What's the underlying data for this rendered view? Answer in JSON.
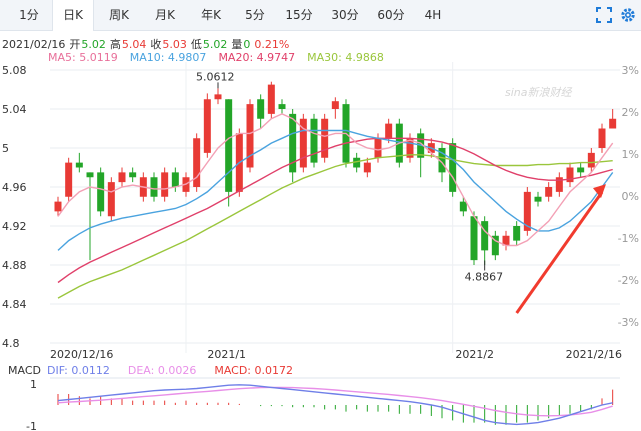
{
  "tabs": [
    "1分",
    "日K",
    "周K",
    "月K",
    "年K",
    "5分",
    "15分",
    "30分",
    "60分",
    "4H"
  ],
  "active_tab": "日K",
  "icons": [
    "fullscreen-icon",
    "settings-icon"
  ],
  "quote": {
    "date": "2021/02/16",
    "open_label": "开",
    "open": "5.02",
    "high_label": "高",
    "high": "5.04",
    "close_label": "收",
    "close": "5.03",
    "low_label": "低",
    "low": "5.02",
    "vol_label": "量",
    "vol": "0",
    "change": "0.21%"
  },
  "ma": {
    "ma5": "MA5: 5.0119",
    "ma10": "MA10: 4.9807",
    "ma20": "MA20: 4.9747",
    "ma30": "MA30: 4.9868"
  },
  "macd_legend": {
    "label": "MACD",
    "dif": "DIF: 0.0112",
    "dea": "DEA: 0.0026",
    "macd": "MACD: 0.0172"
  },
  "watermark": "sina新浪财经",
  "colors": {
    "up": "#e83a35",
    "down": "#23a528",
    "ma5": "#f3a0b5",
    "ma10": "#4aa3df",
    "ma20": "#e0406a",
    "ma30": "#9ac63c",
    "dif": "#6f7fe8",
    "dea": "#e88fe8",
    "arrow": "#f13b2e",
    "bg": "#ffffff"
  },
  "chart_data": {
    "type": "candlestick",
    "y_left_ticks": [
      "5.08",
      "5.04",
      "5",
      "4.96",
      "4.92",
      "4.88",
      "4.84",
      "4.8"
    ],
    "y_right_ticks": [
      "3%",
      "2%",
      "1%",
      "0%",
      "-1%",
      "-2%",
      "-3%"
    ],
    "ylim": [
      4.8,
      5.08
    ],
    "x_labels": [
      "2020/12/16",
      "2021/1",
      "2021/2",
      "2021/2/16"
    ],
    "annotations": [
      "5.0612",
      "4.8867"
    ],
    "candles": [
      [
        4.935,
        4.945,
        4.93,
        4.95
      ],
      [
        4.95,
        4.985,
        4.945,
        4.99
      ],
      [
        4.985,
        4.98,
        4.975,
        4.995
      ],
      [
        4.975,
        4.97,
        4.885,
        4.975
      ],
      [
        4.975,
        4.935,
        4.93,
        4.98
      ],
      [
        4.93,
        4.965,
        4.925,
        4.97
      ],
      [
        4.965,
        4.975,
        4.96,
        4.98
      ],
      [
        4.975,
        4.97,
        4.965,
        4.98
      ],
      [
        4.95,
        4.97,
        4.945,
        4.975
      ],
      [
        4.97,
        4.95,
        4.945,
        4.975
      ],
      [
        4.95,
        4.975,
        4.945,
        4.98
      ],
      [
        4.975,
        4.96,
        4.955,
        4.98
      ],
      [
        4.955,
        4.97,
        4.95,
        4.975
      ],
      [
        4.96,
        5.01,
        4.955,
        5.015
      ],
      [
        4.995,
        5.05,
        4.99,
        5.056
      ],
      [
        5.05,
        5.055,
        5.045,
        5.0612
      ],
      [
        5.05,
        4.955,
        4.94,
        5.05
      ],
      [
        4.955,
        5.015,
        4.95,
        5.02
      ],
      [
        4.98,
        5.045,
        4.975,
        5.05
      ],
      [
        5.05,
        5.03,
        5.02,
        5.055
      ],
      [
        5.035,
        5.065,
        5.03,
        5.068
      ],
      [
        5.045,
        5.04,
        5.035,
        5.05
      ],
      [
        5.035,
        4.975,
        4.965,
        5.04
      ],
      [
        4.98,
        5.03,
        4.975,
        5.035
      ],
      [
        5.03,
        4.985,
        4.98,
        5.035
      ],
      [
        4.99,
        5.03,
        4.985,
        5.035
      ],
      [
        5.04,
        5.048,
        5.03,
        5.052
      ],
      [
        5.045,
        4.985,
        4.98,
        5.05
      ],
      [
        4.99,
        4.98,
        4.975,
        4.995
      ],
      [
        4.975,
        4.985,
        4.97,
        4.99
      ],
      [
        4.99,
        5.01,
        4.985,
        5.015
      ],
      [
        5.01,
        5.025,
        5.005,
        5.03
      ],
      [
        5.025,
        4.985,
        4.98,
        5.03
      ],
      [
        4.99,
        5.01,
        4.985,
        5.015
      ],
      [
        5.015,
        4.99,
        4.97,
        5.02
      ],
      [
        4.995,
        5.005,
        4.99,
        5.01
      ],
      [
        5.0,
        4.975,
        4.965,
        5.005
      ],
      [
        5.005,
        4.955,
        4.95,
        5.01
      ],
      [
        4.945,
        4.935,
        4.93,
        4.95
      ],
      [
        4.93,
        4.885,
        4.88,
        4.935
      ],
      [
        4.925,
        4.895,
        4.88,
        4.93
      ],
      [
        4.91,
        4.89,
        4.885,
        4.915
      ],
      [
        4.9,
        4.91,
        4.895,
        4.915
      ],
      [
        4.92,
        4.905,
        4.9,
        4.925
      ],
      [
        4.915,
        4.955,
        4.91,
        4.96
      ],
      [
        4.95,
        4.945,
        4.94,
        4.955
      ],
      [
        4.95,
        4.96,
        4.945,
        4.965
      ],
      [
        4.955,
        4.97,
        4.95,
        4.975
      ],
      [
        4.965,
        4.98,
        4.96,
        4.985
      ],
      [
        4.98,
        4.975,
        4.97,
        4.985
      ],
      [
        4.98,
        4.995,
        4.975,
        5.0
      ],
      [
        5.0,
        5.02,
        4.995,
        5.025
      ],
      [
        5.02,
        5.03,
        5.02,
        5.04
      ]
    ],
    "ma5": [
      4.93,
      4.945,
      4.955,
      4.96,
      4.958,
      4.955,
      4.96,
      4.962,
      4.96,
      4.958,
      4.958,
      4.96,
      4.963,
      4.97,
      4.985,
      5.0,
      5.01,
      5.015,
      5.015,
      5.02,
      5.03,
      5.035,
      5.03,
      5.02,
      5.015,
      5.012,
      5.015,
      5.015,
      5.005,
      5.0,
      4.998,
      5.0,
      5.005,
      5.008,
      5.005,
      4.995,
      4.985,
      4.97,
      4.95,
      4.93,
      4.915,
      4.905,
      4.9,
      4.9,
      4.905,
      4.915,
      4.925,
      4.94,
      4.955,
      4.965,
      4.975,
      4.99,
      5.005
    ],
    "ma10": [
      4.895,
      4.905,
      4.912,
      4.918,
      4.922,
      4.925,
      4.928,
      4.93,
      4.932,
      4.934,
      4.936,
      4.938,
      4.942,
      4.948,
      4.955,
      4.965,
      4.975,
      4.985,
      4.992,
      4.998,
      5.005,
      5.01,
      5.015,
      5.018,
      5.018,
      5.018,
      5.018,
      5.018,
      5.015,
      5.012,
      5.01,
      5.008,
      5.006,
      5.005,
      5.003,
      5.0,
      4.995,
      4.988,
      4.978,
      4.965,
      4.955,
      4.945,
      4.935,
      4.927,
      4.92,
      4.915,
      4.915,
      4.918,
      4.925,
      4.935,
      4.945,
      4.96,
      4.975
    ],
    "ma20": [
      4.862,
      4.87,
      4.877,
      4.883,
      4.888,
      4.893,
      4.898,
      4.903,
      4.908,
      4.913,
      4.918,
      4.923,
      4.928,
      4.933,
      4.938,
      4.944,
      4.95,
      4.956,
      4.962,
      4.968,
      4.974,
      4.98,
      4.985,
      4.99,
      4.994,
      4.998,
      5.002,
      5.005,
      5.007,
      5.009,
      5.01,
      5.01,
      5.01,
      5.01,
      5.009,
      5.008,
      5.006,
      5.003,
      4.999,
      4.994,
      4.988,
      4.982,
      4.977,
      4.973,
      4.97,
      4.968,
      4.967,
      4.967,
      4.968,
      4.97,
      4.972,
      4.975,
      4.978
    ],
    "ma30": [
      4.846,
      4.852,
      4.858,
      4.863,
      4.867,
      4.871,
      4.875,
      4.88,
      4.885,
      4.89,
      4.895,
      4.9,
      4.905,
      4.911,
      4.917,
      4.923,
      4.929,
      4.935,
      4.941,
      4.947,
      4.953,
      4.959,
      4.964,
      4.969,
      4.973,
      4.977,
      4.981,
      4.984,
      4.986,
      4.988,
      4.99,
      4.991,
      4.992,
      4.993,
      4.993,
      4.992,
      4.99,
      4.988,
      4.986,
      4.984,
      4.983,
      4.982,
      4.982,
      4.982,
      4.982,
      4.983,
      4.983,
      4.984,
      4.984,
      4.985,
      4.985,
      4.986,
      4.987
    ],
    "macd_ticks": [
      "1",
      "-1"
    ],
    "dif": [
      0.2,
      0.25,
      0.3,
      0.35,
      0.4,
      0.45,
      0.5,
      0.55,
      0.6,
      0.65,
      0.68,
      0.7,
      0.72,
      0.75,
      0.8,
      0.85,
      0.9,
      0.92,
      0.9,
      0.85,
      0.8,
      0.75,
      0.7,
      0.65,
      0.6,
      0.55,
      0.5,
      0.45,
      0.4,
      0.35,
      0.3,
      0.25,
      0.2,
      0.15,
      0.08,
      0.0,
      -0.1,
      -0.25,
      -0.4,
      -0.55,
      -0.7,
      -0.8,
      -0.85,
      -0.88,
      -0.85,
      -0.8,
      -0.7,
      -0.6,
      -0.45,
      -0.3,
      -0.15,
      0.0,
      0.1
    ],
    "dea": [
      0.1,
      0.13,
      0.16,
      0.19,
      0.22,
      0.26,
      0.3,
      0.34,
      0.38,
      0.42,
      0.46,
      0.5,
      0.54,
      0.58,
      0.62,
      0.66,
      0.7,
      0.74,
      0.77,
      0.79,
      0.8,
      0.8,
      0.79,
      0.77,
      0.75,
      0.72,
      0.68,
      0.64,
      0.6,
      0.56,
      0.52,
      0.48,
      0.43,
      0.38,
      0.33,
      0.27,
      0.2,
      0.12,
      0.03,
      -0.06,
      -0.15,
      -0.25,
      -0.33,
      -0.4,
      -0.45,
      -0.48,
      -0.49,
      -0.48,
      -0.45,
      -0.4,
      -0.33,
      -0.2,
      -0.05
    ],
    "hist": [
      0.5,
      0.5,
      0.4,
      0.3,
      0.4,
      0.3,
      0.3,
      0.2,
      0.2,
      0.2,
      0.2,
      0.1,
      0.2,
      0.1,
      0.1,
      0.1,
      0.1,
      0.05,
      0.0,
      -0.05,
      -0.05,
      -0.05,
      -0.1,
      -0.1,
      -0.1,
      -0.2,
      -0.2,
      -0.3,
      -0.2,
      -0.3,
      -0.3,
      -0.3,
      -0.4,
      -0.4,
      -0.4,
      -0.5,
      -0.6,
      -0.7,
      -0.8,
      -0.8,
      -0.8,
      -0.9,
      -0.9,
      -0.8,
      -0.8,
      -0.7,
      -0.6,
      -0.5,
      -0.4,
      -0.3,
      -0.2,
      0.3,
      0.7
    ]
  }
}
